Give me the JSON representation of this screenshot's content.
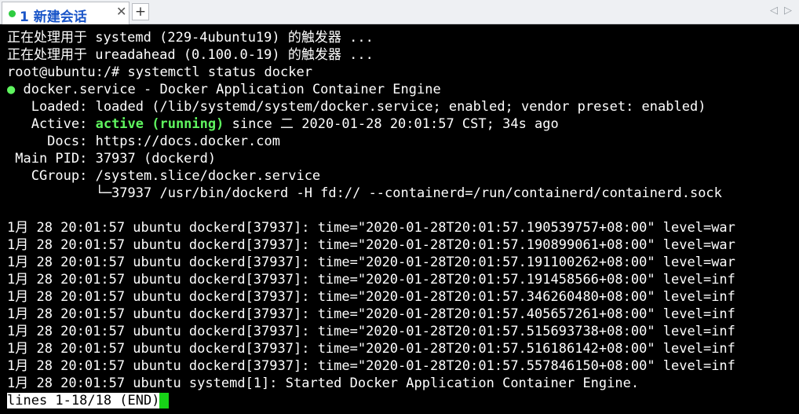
{
  "tab": {
    "title": "1 新建会话",
    "close_glyph": "✕",
    "add_glyph": "+"
  },
  "nav": {
    "left": "◁",
    "right": "▷"
  },
  "terminal": {
    "line1": "正在处理用于 systemd (229-4ubuntu19) 的触发器 ...",
    "line2": "正在处理用于 ureadahead (0.100.0-19) 的触发器 ...",
    "line3": "root@ubuntu:/# systemctl status docker",
    "line4_bullet": "●",
    "line4": " docker.service - Docker Application Container Engine",
    "line5": "   Loaded: loaded (/lib/systemd/system/docker.service; enabled; vendor preset: enabled)",
    "line6_label": "   Active: ",
    "line6_state": "active (running)",
    "line6_rest": " since 二 2020-01-28 20:01:57 CST; 34s ago",
    "line7": "     Docs: https://docs.docker.com",
    "line8": " Main PID: 37937 (dockerd)",
    "line9": "   CGroup: /system.slice/docker.service",
    "line10": "           └─37937 /usr/bin/dockerd -H fd:// --containerd=/run/containerd/containerd.sock",
    "log": [
      "1月 28 20:01:57 ubuntu dockerd[37937]: time=\"2020-01-28T20:01:57.190539757+08:00\" level=war",
      "1月 28 20:01:57 ubuntu dockerd[37937]: time=\"2020-01-28T20:01:57.190899061+08:00\" level=war",
      "1月 28 20:01:57 ubuntu dockerd[37937]: time=\"2020-01-28T20:01:57.191100262+08:00\" level=war",
      "1月 28 20:01:57 ubuntu dockerd[37937]: time=\"2020-01-28T20:01:57.191458566+08:00\" level=inf",
      "1月 28 20:01:57 ubuntu dockerd[37937]: time=\"2020-01-28T20:01:57.346260480+08:00\" level=inf",
      "1月 28 20:01:57 ubuntu dockerd[37937]: time=\"2020-01-28T20:01:57.405657261+08:00\" level=inf",
      "1月 28 20:01:57 ubuntu dockerd[37937]: time=\"2020-01-28T20:01:57.515693738+08:00\" level=inf",
      "1月 28 20:01:57 ubuntu dockerd[37937]: time=\"2020-01-28T20:01:57.516186142+08:00\" level=inf",
      "1月 28 20:01:57 ubuntu dockerd[37937]: time=\"2020-01-28T20:01:57.557846150+08:00\" level=inf",
      "1月 28 20:01:57 ubuntu systemd[1]: Started Docker Application Container Engine."
    ],
    "pager_status": "lines 1-18/18 (END)"
  },
  "colors": {
    "active_green": "#5ff55f",
    "cursor_green": "#17d217",
    "tab_title_blue": "#1a55c8",
    "background": "#000000"
  }
}
